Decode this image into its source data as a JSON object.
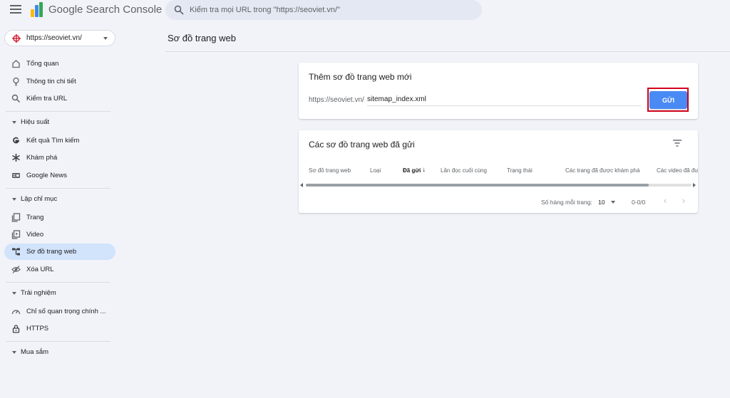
{
  "app": {
    "brand": "Google Search Console"
  },
  "search": {
    "placeholder": "Kiểm tra mọi URL trong \"https://seoviet.vn/\""
  },
  "property": {
    "label": "https://seoviet.vn/"
  },
  "sidebar": {
    "top_items": [
      {
        "label": "Tổng quan",
        "icon": "home-icon"
      },
      {
        "label": "Thông tin chi tiết",
        "icon": "lightbulb-icon"
      },
      {
        "label": "Kiểm tra URL",
        "icon": "search-icon"
      }
    ],
    "performance": {
      "heading": "Hiệu suất",
      "items": [
        {
          "label": "Kết quả Tìm kiếm",
          "icon": "google-g-icon"
        },
        {
          "label": "Khám phá",
          "icon": "asterisk-icon"
        },
        {
          "label": "Google News",
          "icon": "news-icon"
        }
      ]
    },
    "indexing": {
      "heading": "Lập chỉ mục",
      "items": [
        {
          "label": "Trang",
          "icon": "pages-icon"
        },
        {
          "label": "Video",
          "icon": "video-icon"
        },
        {
          "label": "Sơ đồ trang web",
          "icon": "sitemap-icon",
          "active": true
        },
        {
          "label": "Xóa URL",
          "icon": "eye-off-icon"
        }
      ]
    },
    "experience": {
      "heading": "Trải nghiệm",
      "items": [
        {
          "label": "Chỉ số quan trọng chính ...",
          "icon": "gauge-icon"
        },
        {
          "label": "HTTPS",
          "icon": "lock-icon"
        }
      ]
    },
    "shopping": {
      "heading": "Mua sắm"
    }
  },
  "page": {
    "title": "Sơ đồ trang web"
  },
  "add_sitemap": {
    "title": "Thêm sơ đồ trang web mới",
    "prefix": "https://seoviet.vn/",
    "value": "sitemap_index.xml",
    "submit_label": "GỬI"
  },
  "submitted": {
    "title": "Các sơ đồ trang web đã gửi",
    "columns": [
      "Sơ đồ trang web",
      "Loại",
      "Đã gửi",
      "Lần đọc cuối cùng",
      "Trạng thái",
      "Các trang đã được khám phá",
      "Các video đã được khám phá"
    ],
    "rows_per_page_label": "Số hàng mỗi trang:",
    "rows_per_page": "10",
    "range": "0-0/0"
  },
  "colors": {
    "accent": "#4a8af4",
    "active_nav": "#d2e3fc",
    "highlight": "#d0021b",
    "background": "#f1f3f8"
  }
}
